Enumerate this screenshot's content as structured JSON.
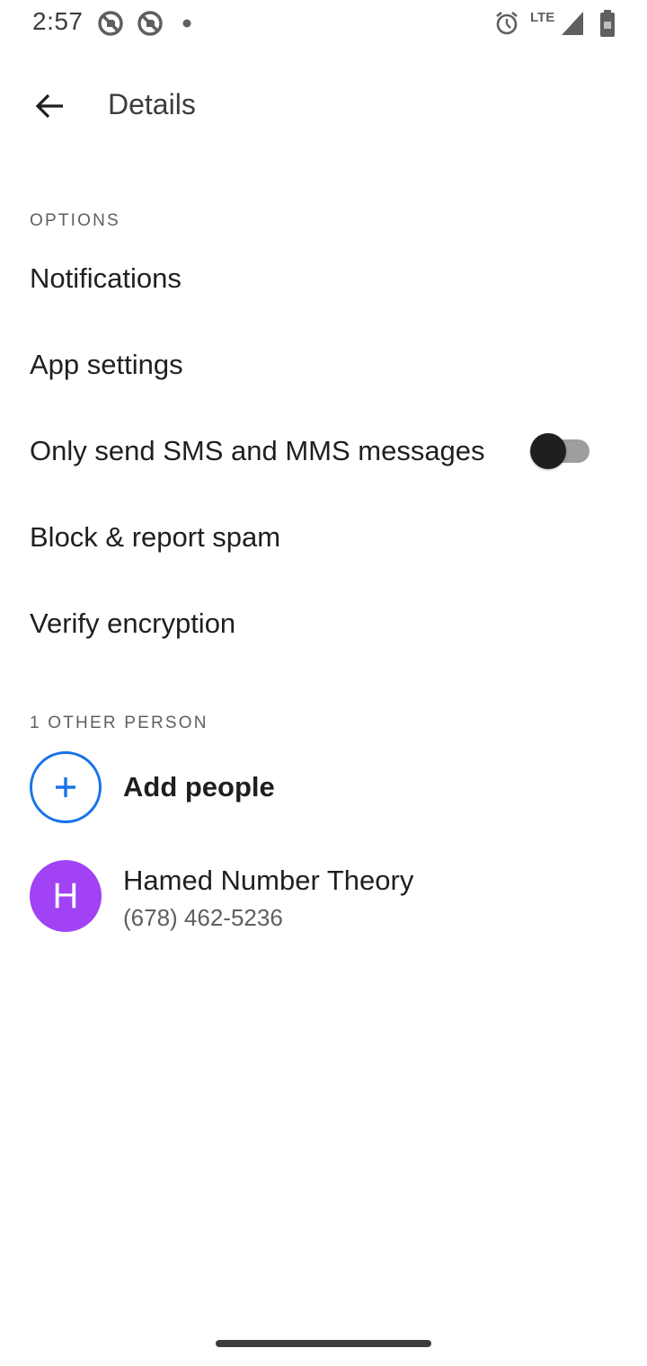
{
  "status_bar": {
    "time": "2:57",
    "network": "LTE",
    "icons": [
      "no-sim-circle-icon",
      "no-sim-circle-icon",
      "dot-icon",
      "alarm-icon",
      "signal-icon",
      "battery-icon"
    ]
  },
  "app_bar": {
    "back_icon": "arrow-back-icon",
    "title": "Details"
  },
  "options": {
    "header": "OPTIONS",
    "items": [
      {
        "label": "Notifications"
      },
      {
        "label": "App settings"
      },
      {
        "label": "Only send SMS and MMS messages",
        "toggle": false
      },
      {
        "label": "Block & report spam"
      },
      {
        "label": "Verify encryption"
      }
    ]
  },
  "people": {
    "header": "1 OTHER PERSON",
    "add_label": "Add people",
    "add_icon": "plus-icon",
    "contacts": [
      {
        "initial": "H",
        "name": "Hamed Number Theory",
        "phone": "(678) 462-5236",
        "avatar_color": "#a142f4"
      }
    ]
  },
  "colors": {
    "accent": "#1a73e8",
    "toggle_off_thumb": "#1f1f1f",
    "toggle_off_track": "#9e9e9e"
  }
}
